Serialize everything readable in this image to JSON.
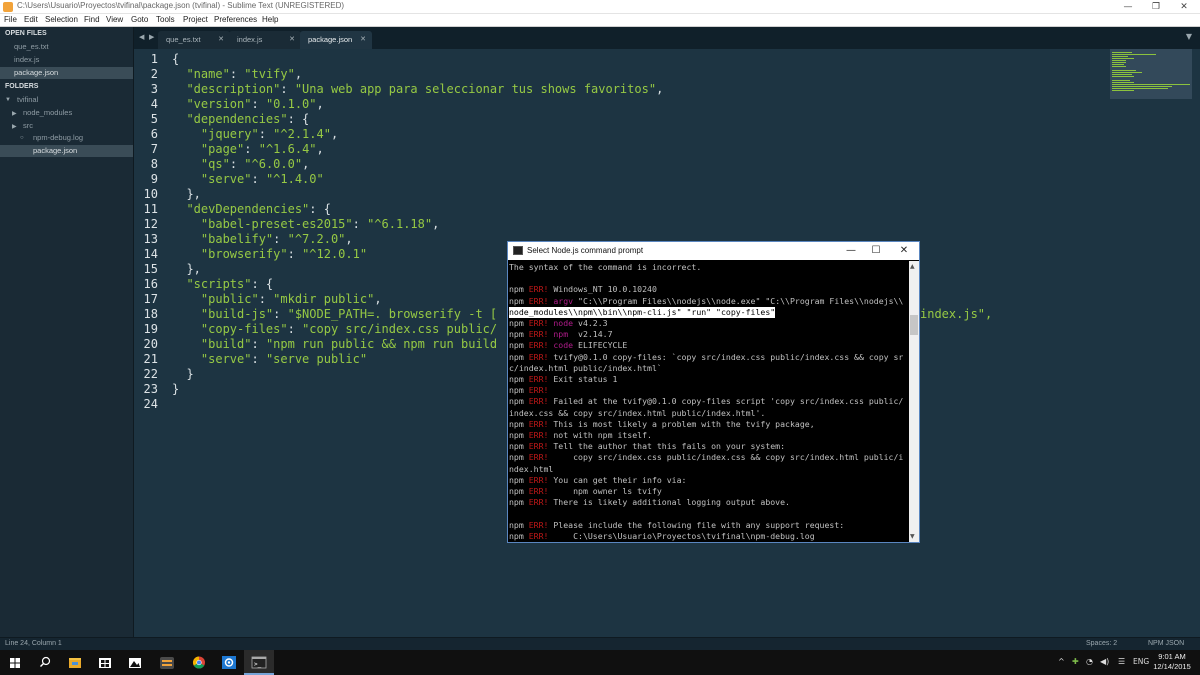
{
  "window": {
    "title": "C:\\Users\\Usuario\\Proyectos\\tvifinal\\package.json (tvifinal) - Sublime Text (UNREGISTERED)",
    "minimize": "—",
    "maximize": "❐",
    "close": "✕"
  },
  "menu": [
    "File",
    "Edit",
    "Selection",
    "Find",
    "View",
    "Goto",
    "Tools",
    "Project",
    "Preferences",
    "Help"
  ],
  "sidebar": {
    "open_files_header": "OPEN FILES",
    "open_files": [
      "que_es.txt",
      "index.js",
      "package.json"
    ],
    "folders_header": "FOLDERS",
    "root_folder": "tvifinal",
    "folder_items": [
      "node_modules",
      "src",
      "npm-debug.log",
      "package.json"
    ]
  },
  "tabs": [
    {
      "label": "que_es.txt",
      "close": "✕"
    },
    {
      "label": "index.js",
      "close": "✕"
    },
    {
      "label": "package.json",
      "close": "✕"
    }
  ],
  "tab_nav": {
    "left": "◀",
    "right": "▶",
    "dropdown": "▼"
  },
  "editor": {
    "line_numbers": [
      "1",
      "2",
      "3",
      "4",
      "5",
      "6",
      "7",
      "8",
      "9",
      "10",
      "11",
      "12",
      "13",
      "14",
      "15",
      "16",
      "17",
      "18",
      "19",
      "20",
      "21",
      "22",
      "23",
      "24"
    ],
    "code_lines": [
      [
        {
          "t": "p",
          "v": "{"
        }
      ],
      [
        {
          "t": "p",
          "v": "  "
        },
        {
          "t": "k",
          "v": "\"name\""
        },
        {
          "t": "p",
          "v": ": "
        },
        {
          "t": "s",
          "v": "\"tvify\""
        },
        {
          "t": "p",
          "v": ","
        }
      ],
      [
        {
          "t": "p",
          "v": "  "
        },
        {
          "t": "k",
          "v": "\"description\""
        },
        {
          "t": "p",
          "v": ": "
        },
        {
          "t": "s",
          "v": "\"Una web app para seleccionar tus shows favoritos\""
        },
        {
          "t": "p",
          "v": ","
        }
      ],
      [
        {
          "t": "p",
          "v": "  "
        },
        {
          "t": "k",
          "v": "\"version\""
        },
        {
          "t": "p",
          "v": ": "
        },
        {
          "t": "s",
          "v": "\"0.1.0\""
        },
        {
          "t": "p",
          "v": ","
        }
      ],
      [
        {
          "t": "p",
          "v": "  "
        },
        {
          "t": "k",
          "v": "\"dependencies\""
        },
        {
          "t": "p",
          "v": ": {"
        }
      ],
      [
        {
          "t": "p",
          "v": "    "
        },
        {
          "t": "k",
          "v": "\"jquery\""
        },
        {
          "t": "p",
          "v": ": "
        },
        {
          "t": "s",
          "v": "\"^2.1.4\""
        },
        {
          "t": "p",
          "v": ","
        }
      ],
      [
        {
          "t": "p",
          "v": "    "
        },
        {
          "t": "k",
          "v": "\"page\""
        },
        {
          "t": "p",
          "v": ": "
        },
        {
          "t": "s",
          "v": "\"^1.6.4\""
        },
        {
          "t": "p",
          "v": ","
        }
      ],
      [
        {
          "t": "p",
          "v": "    "
        },
        {
          "t": "k",
          "v": "\"qs\""
        },
        {
          "t": "p",
          "v": ": "
        },
        {
          "t": "s",
          "v": "\"^6.0.0\""
        },
        {
          "t": "p",
          "v": ","
        }
      ],
      [
        {
          "t": "p",
          "v": "    "
        },
        {
          "t": "k",
          "v": "\"serve\""
        },
        {
          "t": "p",
          "v": ": "
        },
        {
          "t": "s",
          "v": "\"^1.4.0\""
        }
      ],
      [
        {
          "t": "p",
          "v": "  },"
        }
      ],
      [
        {
          "t": "p",
          "v": "  "
        },
        {
          "t": "k",
          "v": "\"devDependencies\""
        },
        {
          "t": "p",
          "v": ": {"
        }
      ],
      [
        {
          "t": "p",
          "v": "    "
        },
        {
          "t": "k",
          "v": "\"babel-preset-es2015\""
        },
        {
          "t": "p",
          "v": ": "
        },
        {
          "t": "s",
          "v": "\"^6.1.18\""
        },
        {
          "t": "p",
          "v": ","
        }
      ],
      [
        {
          "t": "p",
          "v": "    "
        },
        {
          "t": "k",
          "v": "\"babelify\""
        },
        {
          "t": "p",
          "v": ": "
        },
        {
          "t": "s",
          "v": "\"^7.2.0\""
        },
        {
          "t": "p",
          "v": ","
        }
      ],
      [
        {
          "t": "p",
          "v": "    "
        },
        {
          "t": "k",
          "v": "\"browserify\""
        },
        {
          "t": "p",
          "v": ": "
        },
        {
          "t": "s",
          "v": "\"^12.0.1\""
        }
      ],
      [
        {
          "t": "p",
          "v": "  },"
        }
      ],
      [
        {
          "t": "p",
          "v": "  "
        },
        {
          "t": "k",
          "v": "\"scripts\""
        },
        {
          "t": "p",
          "v": ": {"
        }
      ],
      [
        {
          "t": "p",
          "v": "    "
        },
        {
          "t": "k",
          "v": "\"public\""
        },
        {
          "t": "p",
          "v": ": "
        },
        {
          "t": "s",
          "v": "\"mkdir public\""
        },
        {
          "t": "p",
          "v": ","
        }
      ],
      [
        {
          "t": "p",
          "v": "    "
        },
        {
          "t": "k",
          "v": "\"build-js\""
        },
        {
          "t": "p",
          "v": ": "
        },
        {
          "t": "s",
          "v": "\"$NODE_PATH=. browserify -t [ "
        }
      ],
      [
        {
          "t": "p",
          "v": "    "
        },
        {
          "t": "k",
          "v": "\"copy-files\""
        },
        {
          "t": "p",
          "v": ": "
        },
        {
          "t": "s",
          "v": "\"copy src/index.css public/"
        }
      ],
      [
        {
          "t": "p",
          "v": "    "
        },
        {
          "t": "k",
          "v": "\"build\""
        },
        {
          "t": "p",
          "v": ": "
        },
        {
          "t": "s",
          "v": "\"npm run public && npm run build"
        }
      ],
      [
        {
          "t": "p",
          "v": "    "
        },
        {
          "t": "k",
          "v": "\"serve\""
        },
        {
          "t": "p",
          "v": ": "
        },
        {
          "t": "s",
          "v": "\"serve public\""
        }
      ],
      [
        {
          "t": "p",
          "v": "  }"
        }
      ],
      [
        {
          "t": "p",
          "v": "}"
        }
      ],
      []
    ],
    "overflow_text": "index.js\","
  },
  "status": {
    "position": "Line 24, Column 1",
    "spaces": "Spaces: 2",
    "syntax": "NPM JSON"
  },
  "cmd": {
    "title": "Select Node.js command prompt",
    "minimize": "—",
    "maximize": "☐",
    "close": "✕",
    "lines": [
      [
        {
          "c": "n",
          "v": "The syntax of the command is incorrect."
        }
      ],
      [],
      [
        {
          "c": "n",
          "v": "npm "
        },
        {
          "c": "err",
          "v": "ERR!"
        },
        {
          "c": "n",
          "v": " Windows_NT 10.0.10240"
        }
      ],
      [
        {
          "c": "n",
          "v": "npm "
        },
        {
          "c": "err",
          "v": "ERR!"
        },
        {
          "c": "mag",
          "v": " argv"
        },
        {
          "c": "n",
          "v": " \"C:\\\\Program Files\\\\nodejs\\\\node.exe\" \"C:\\\\Program Files\\\\nodejs\\\\"
        }
      ],
      [
        {
          "c": "sel",
          "v": "node_modules\\\\npm\\\\bin\\\\npm-cli.js\" \"run\" \"copy-files\""
        }
      ],
      [
        {
          "c": "n",
          "v": "npm "
        },
        {
          "c": "err",
          "v": "ERR!"
        },
        {
          "c": "mag",
          "v": " node"
        },
        {
          "c": "n",
          "v": " v4.2.3"
        }
      ],
      [
        {
          "c": "n",
          "v": "npm "
        },
        {
          "c": "err",
          "v": "ERR!"
        },
        {
          "c": "mag",
          "v": " npm "
        },
        {
          "c": "n",
          "v": " v2.14.7"
        }
      ],
      [
        {
          "c": "n",
          "v": "npm "
        },
        {
          "c": "err",
          "v": "ERR!"
        },
        {
          "c": "mag",
          "v": " code"
        },
        {
          "c": "n",
          "v": " ELIFECYCLE"
        }
      ],
      [
        {
          "c": "n",
          "v": "npm "
        },
        {
          "c": "err",
          "v": "ERR!"
        },
        {
          "c": "n",
          "v": " tvify@0.1.0 copy-files: `copy src/index.css public/index.css && copy sr"
        }
      ],
      [
        {
          "c": "n",
          "v": "c/index.html public/index.html`"
        }
      ],
      [
        {
          "c": "n",
          "v": "npm "
        },
        {
          "c": "err",
          "v": "ERR!"
        },
        {
          "c": "n",
          "v": " Exit status 1"
        }
      ],
      [
        {
          "c": "n",
          "v": "npm "
        },
        {
          "c": "err",
          "v": "ERR!"
        }
      ],
      [
        {
          "c": "n",
          "v": "npm "
        },
        {
          "c": "err",
          "v": "ERR!"
        },
        {
          "c": "n",
          "v": " Failed at the tvify@0.1.0 copy-files script 'copy src/index.css public/"
        }
      ],
      [
        {
          "c": "n",
          "v": "index.css && copy src/index.html public/index.html'."
        }
      ],
      [
        {
          "c": "n",
          "v": "npm "
        },
        {
          "c": "err",
          "v": "ERR!"
        },
        {
          "c": "n",
          "v": " This is most likely a problem with the tvify package,"
        }
      ],
      [
        {
          "c": "n",
          "v": "npm "
        },
        {
          "c": "err",
          "v": "ERR!"
        },
        {
          "c": "n",
          "v": " not with npm itself."
        }
      ],
      [
        {
          "c": "n",
          "v": "npm "
        },
        {
          "c": "err",
          "v": "ERR!"
        },
        {
          "c": "n",
          "v": " Tell the author that this fails on your system:"
        }
      ],
      [
        {
          "c": "n",
          "v": "npm "
        },
        {
          "c": "err",
          "v": "ERR!"
        },
        {
          "c": "n",
          "v": "     copy src/index.css public/index.css && copy src/index.html public/i"
        }
      ],
      [
        {
          "c": "n",
          "v": "ndex.html"
        }
      ],
      [
        {
          "c": "n",
          "v": "npm "
        },
        {
          "c": "err",
          "v": "ERR!"
        },
        {
          "c": "n",
          "v": " You can get their info via:"
        }
      ],
      [
        {
          "c": "n",
          "v": "npm "
        },
        {
          "c": "err",
          "v": "ERR!"
        },
        {
          "c": "n",
          "v": "     npm owner ls tvify"
        }
      ],
      [
        {
          "c": "n",
          "v": "npm "
        },
        {
          "c": "err",
          "v": "ERR!"
        },
        {
          "c": "n",
          "v": " There is likely additional logging output above."
        }
      ],
      [],
      [
        {
          "c": "n",
          "v": "npm "
        },
        {
          "c": "err",
          "v": "ERR!"
        },
        {
          "c": "n",
          "v": " Please include the following file with any support request:"
        }
      ],
      [
        {
          "c": "n",
          "v": "npm "
        },
        {
          "c": "err",
          "v": "ERR!"
        },
        {
          "c": "n",
          "v": "     C:\\Users\\Usuario\\Proyectos\\tvifinal\\npm-debug.log"
        }
      ]
    ]
  },
  "taskbar": {
    "icons": [
      "windows-icon",
      "search-icon",
      "file-explorer-icon",
      "store-icon",
      "photos-icon",
      "sublime-text-icon",
      "chrome-icon",
      "settings-icon",
      "cmd-icon"
    ],
    "tray": "^",
    "language": "ENG",
    "time": "9:01 AM",
    "date": "12/14/2015"
  },
  "colors": {
    "editor_bg": "#1d3442",
    "string_green": "#96c944",
    "sidebar_bg": "#1a2a35",
    "cmd_error_red": "#c01818"
  }
}
